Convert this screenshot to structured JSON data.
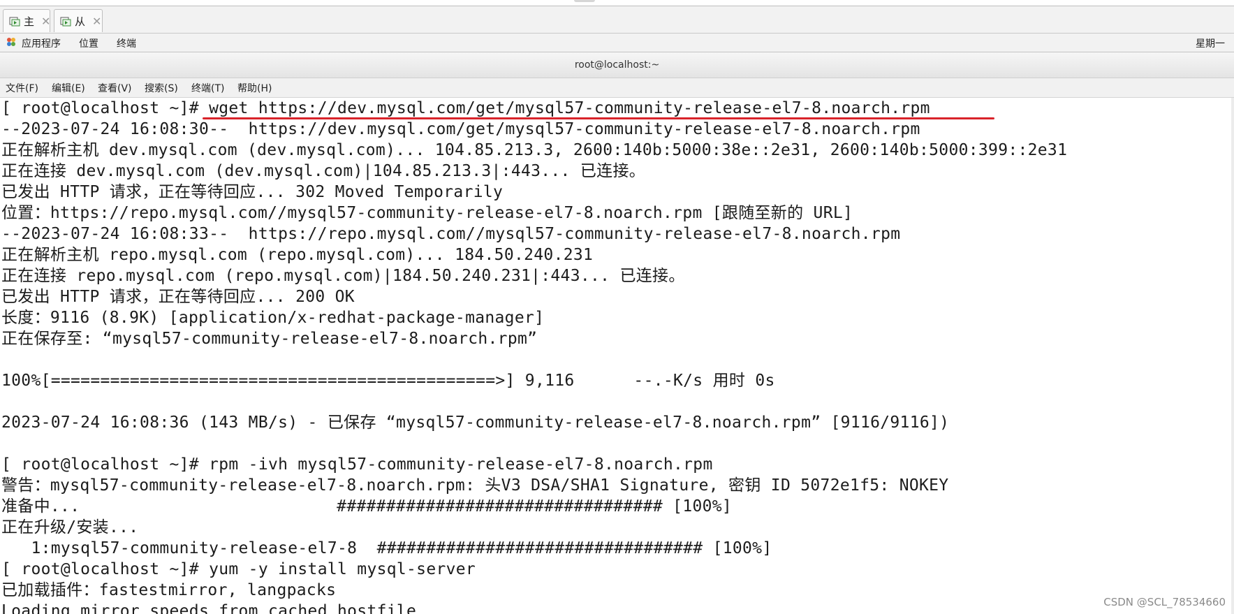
{
  "window": {
    "tabs": [
      {
        "label": "主"
      },
      {
        "label": "从"
      }
    ],
    "tab_close_glyph": "✕"
  },
  "top_menu": {
    "applications": "应用程序",
    "places": "位置",
    "terminal": "终端",
    "clock": "星期一"
  },
  "title": "root@localhost:~",
  "terminal_menu": [
    "文件(F)",
    "编辑(E)",
    "查看(V)",
    "搜索(S)",
    "终端(T)",
    "帮助(H)"
  ],
  "terminal_lines": [
    "[ root@localhost ~]# wget https://dev.mysql.com/get/mysql57-community-release-el7-8.noarch.rpm",
    "--2023-07-24 16:08:30--  https://dev.mysql.com/get/mysql57-community-release-el7-8.noarch.rpm",
    "正在解析主机 dev.mysql.com (dev.mysql.com)... 104.85.213.3, 2600:140b:5000:38e::2e31, 2600:140b:5000:399::2e31",
    "正在连接 dev.mysql.com (dev.mysql.com)|104.85.213.3|:443... 已连接。",
    "已发出 HTTP 请求，正在等待回应... 302 Moved Temporarily",
    "位置：https://repo.mysql.com//mysql57-community-release-el7-8.noarch.rpm [跟随至新的 URL]",
    "--2023-07-24 16:08:33--  https://repo.mysql.com//mysql57-community-release-el7-8.noarch.rpm",
    "正在解析主机 repo.mysql.com (repo.mysql.com)... 184.50.240.231",
    "正在连接 repo.mysql.com (repo.mysql.com)|184.50.240.231|:443... 已连接。",
    "已发出 HTTP 请求，正在等待回应... 200 OK",
    "长度：9116 (8.9K) [application/x-redhat-package-manager]",
    "正在保存至: “mysql57-community-release-el7-8.noarch.rpm”",
    "",
    "100%[=============================================>] 9,116      --.-K/s 用时 0s",
    "",
    "2023-07-24 16:08:36 (143 MB/s) - 已保存 “mysql57-community-release-el7-8.noarch.rpm” [9116/9116])",
    "",
    "[ root@localhost ~]# rpm -ivh mysql57-community-release-el7-8.noarch.rpm",
    "警告：mysql57-community-release-el7-8.noarch.rpm: 头V3 DSA/SHA1 Signature, 密钥 ID 5072e1f5: NOKEY",
    "准备中...                          ################################# [100%]",
    "正在升级/安装...",
    "   1:mysql57-community-release-el7-8  ################################# [100%]",
    "[ root@localhost ~]# yum -y install mysql-server",
    "已加载插件：fastestmirror, langpacks",
    "Loading mirror speeds from cached hostfile"
  ],
  "watermark": "CSDN @SCL_78534660",
  "colors": {
    "highlight_underline": "#d9232a",
    "terminal_bg": "#ffffff",
    "terminal_fg": "#1c1c1c"
  },
  "icons": {
    "tab": "terminal-icon",
    "applications": "apps-icon"
  }
}
